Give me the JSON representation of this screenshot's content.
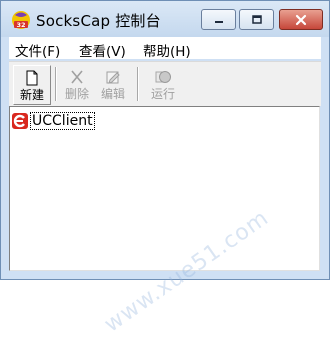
{
  "window": {
    "title": "SocksCap 控制台",
    "app_icon": "sockscap-32-icon",
    "controls": {
      "minimize": "minimize-icon",
      "maximize": "maximize-icon",
      "close": "close-icon"
    }
  },
  "menu": {
    "items": [
      {
        "label": "文件(F)"
      },
      {
        "label": "查看(V)"
      },
      {
        "label": "帮助(H)"
      }
    ]
  },
  "toolbar": {
    "buttons": [
      {
        "label": "新建",
        "icon": "new-document-icon",
        "enabled": true
      },
      {
        "label": "删除",
        "icon": "delete-x-icon",
        "enabled": false
      },
      {
        "label": "编辑",
        "icon": "edit-icon",
        "enabled": false
      },
      {
        "label": "运行",
        "icon": "run-icon",
        "enabled": false
      }
    ]
  },
  "list": {
    "items": [
      {
        "label": "UCClient",
        "icon": "uc-browser-icon"
      }
    ]
  },
  "watermark": "www.xue51.com",
  "colors": {
    "frame": "#cfe0f4",
    "close_button": "#c6473a",
    "toolbar": "#f0f0f0",
    "disabled_text": "#a0a0a0"
  }
}
